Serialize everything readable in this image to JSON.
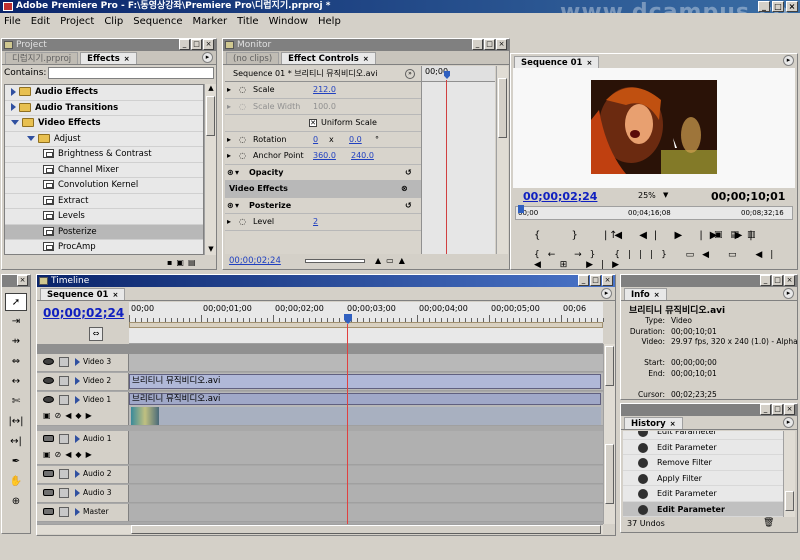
{
  "app": {
    "title": "Adobe Premiere Pro - F:\\동영상강좌\\Premiere Pro\\디럽지기.prproj *",
    "watermark": "www.dcampus.co.kr"
  },
  "menu": [
    "File",
    "Edit",
    "Project",
    "Clip",
    "Sequence",
    "Marker",
    "Title",
    "Window",
    "Help"
  ],
  "project_panel": {
    "title": "Project",
    "tabs": [
      "디럽지기.prproj",
      "Effects"
    ],
    "contains_label": "Contains:",
    "contains_value": "",
    "items": [
      {
        "label": "Audio Effects",
        "kind": "folder",
        "level": 0,
        "open": false
      },
      {
        "label": "Audio Transitions",
        "kind": "folder",
        "level": 0,
        "open": false
      },
      {
        "label": "Video Effects",
        "kind": "folder",
        "level": 0,
        "open": true
      },
      {
        "label": "Adjust",
        "kind": "folder",
        "level": 1,
        "open": true
      },
      {
        "label": "Brightness & Contrast",
        "kind": "effect",
        "level": 2
      },
      {
        "label": "Channel Mixer",
        "kind": "effect",
        "level": 2
      },
      {
        "label": "Convolution Kernel",
        "kind": "effect",
        "level": 2
      },
      {
        "label": "Extract",
        "kind": "effect",
        "level": 2
      },
      {
        "label": "Levels",
        "kind": "effect",
        "level": 2
      },
      {
        "label": "Posterize",
        "kind": "effect",
        "level": 2,
        "selected": true
      },
      {
        "label": "ProcAmp",
        "kind": "effect",
        "level": 2
      }
    ]
  },
  "monitor_panel": {
    "title": "Monitor",
    "tabs": [
      "(no clips)",
      "Effect Controls"
    ],
    "header": "Sequence 01 * 브리티니 뮤직비디오.avi",
    "timecode_mini": "00;00",
    "rows": [
      {
        "label": "Scale",
        "value": "212.0",
        "indent": 2
      },
      {
        "label": "Scale Width",
        "value": "100.0",
        "indent": 2,
        "disabled": true
      },
      {
        "label": "Uniform Scale",
        "checkbox": true
      },
      {
        "label": "Rotation",
        "value": "0",
        "value2": "x",
        "value3": "0.0",
        "value4": "°",
        "indent": 2
      },
      {
        "label": "Anchor Point",
        "value": "360.0",
        "value2": "240.0",
        "indent": 2
      },
      {
        "label": "Opacity",
        "bold": true,
        "indent": 1
      },
      {
        "label": "Video Effects",
        "section": true
      },
      {
        "label": "Posterize",
        "bold": true,
        "indent": 1
      },
      {
        "label": "Level",
        "value": "2",
        "indent": 2
      }
    ],
    "footer_timecode": "00;00;02;24"
  },
  "program_panel": {
    "tab": "Sequence 01",
    "timecode_current": "00;00;02;24",
    "zoom": "25%",
    "timecode_duration": "00;00;10;01",
    "ruler": [
      "00;00",
      "00;04;16;08",
      "00;08;32;16"
    ]
  },
  "timeline_panel": {
    "title": "Timeline",
    "tab": "Sequence 01",
    "timecode": "00;00;02;24",
    "ruler": [
      "00;00",
      "00;00;01;00",
      "00;00;02;00",
      "00;00;03;00",
      "00;00;04;00",
      "00;00;05;00",
      "00;06"
    ],
    "tracks": [
      {
        "label": "Video 3",
        "type": "video"
      },
      {
        "label": "Video 2",
        "type": "video",
        "clip": "브리티니 뮤직비디오.avi"
      },
      {
        "label": "Video 1",
        "type": "video",
        "clip": "브리티니 뮤직비디오.avi",
        "tall": true
      },
      {
        "label": "Audio 1",
        "type": "audio",
        "tall": true
      },
      {
        "label": "Audio 2",
        "type": "audio"
      },
      {
        "label": "Audio 3",
        "type": "audio"
      },
      {
        "label": "Master",
        "type": "audio"
      }
    ]
  },
  "info_panel": {
    "tab": "Info",
    "name": "브리티니 뮤직비디오.avi",
    "rows": [
      {
        "k": "Type:",
        "v": "Video"
      },
      {
        "k": "Duration:",
        "v": "00;00;10;01"
      },
      {
        "k": "Video:",
        "v": "29.97 fps, 320 x 240 (1.0) - Alpha"
      },
      {
        "k": "",
        "v": ""
      },
      {
        "k": "Start:",
        "v": "00;00;00;00"
      },
      {
        "k": "End:",
        "v": "00;00;10;01"
      },
      {
        "k": "",
        "v": ""
      },
      {
        "k": "Cursor:",
        "v": "00;02;23;25"
      }
    ]
  },
  "history_panel": {
    "tab": "History",
    "items": [
      "Edit Parameter",
      "Edit Parameter",
      "Remove Filter",
      "Apply Filter",
      "Edit Parameter",
      "Edit Parameter"
    ],
    "footer": "37 Undos"
  }
}
